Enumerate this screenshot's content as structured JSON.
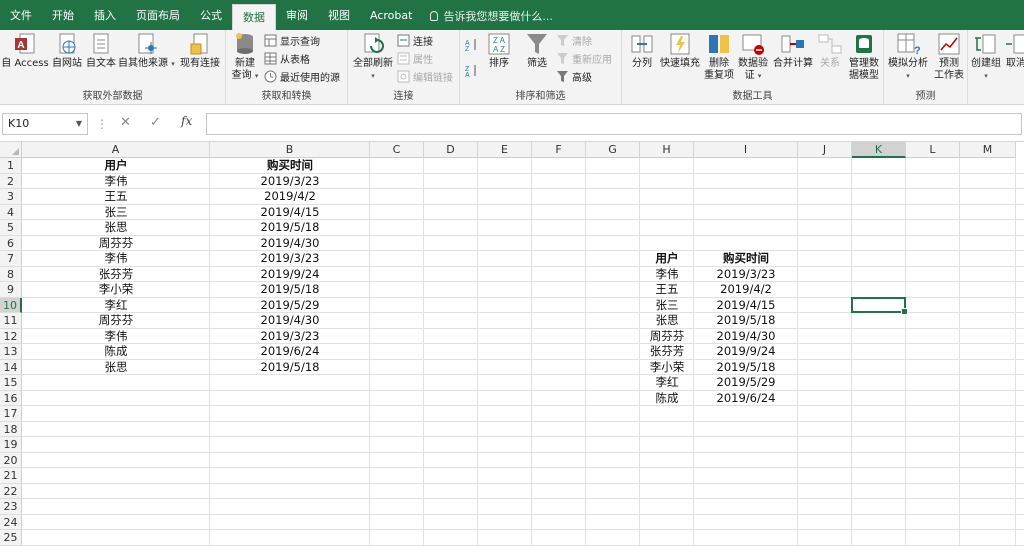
{
  "menu": {
    "tabs": [
      "文件",
      "开始",
      "插入",
      "页面布局",
      "公式",
      "数据",
      "审阅",
      "视图",
      "Acrobat"
    ],
    "active_tab": "数据",
    "tell_me": "告诉我您想要做什么..."
  },
  "ribbon": {
    "get_external": {
      "label": "获取外部数据",
      "access": "自 Access",
      "web": "自网站",
      "text": "自文本",
      "other": "自其他来源",
      "existing": "现有连接"
    },
    "get_transform": {
      "label": "获取和转换",
      "new_query_1": "新建",
      "new_query_2": "查询",
      "show_queries": "显示查询",
      "from_table": "从表格",
      "recent_sources": "最近使用的源"
    },
    "connections": {
      "label": "连接",
      "refresh_all": "全部刷新",
      "connections": "连接",
      "properties": "属性",
      "edit_links": "编辑链接"
    },
    "sort_filter": {
      "label": "排序和筛选",
      "sort": "排序",
      "filter": "筛选",
      "clear": "清除",
      "reapply": "重新应用",
      "advanced": "高级"
    },
    "data_tools": {
      "label": "数据工具",
      "text_to_columns": "分列",
      "flash_fill": "快速填充",
      "remove_dup_1": "删除",
      "remove_dup_2": "重复项",
      "validation_1": "数据验",
      "validation_2": "证",
      "consolidate": "合并计算",
      "relationships": "关系",
      "data_model_1": "管理数",
      "data_model_2": "据模型"
    },
    "forecast": {
      "label": "预测",
      "what_if": "模拟分析",
      "forecast_sheet_1": "预测",
      "forecast_sheet_2": "工作表"
    },
    "outline": {
      "group": "创建组",
      "ungroup": "取消"
    }
  },
  "formula_bar": {
    "name_box": "K10",
    "fx": "fx",
    "formula": ""
  },
  "sheet": {
    "columns": [
      "A",
      "B",
      "C",
      "D",
      "E",
      "F",
      "G",
      "H",
      "I",
      "J",
      "K",
      "L",
      "M"
    ],
    "rows": [
      "1",
      "2",
      "3",
      "4",
      "5",
      "6",
      "7",
      "8",
      "9",
      "10",
      "11",
      "12",
      "13",
      "14",
      "15",
      "16",
      "17",
      "18",
      "19",
      "20",
      "21",
      "22",
      "23",
      "24",
      "25"
    ],
    "selected_cell": "K10",
    "table_left": {
      "header": [
        "用户",
        "购买时间"
      ],
      "rows": [
        [
          "李伟",
          "2019/3/23"
        ],
        [
          "王五",
          "2019/4/2"
        ],
        [
          "张三",
          "2019/4/15"
        ],
        [
          "张思",
          "2019/5/18"
        ],
        [
          "周芬芬",
          "2019/4/30"
        ],
        [
          "李伟",
          "2019/3/23"
        ],
        [
          "张芬芳",
          "2019/9/24"
        ],
        [
          "李小荣",
          "2019/5/18"
        ],
        [
          "李红",
          "2019/5/29"
        ],
        [
          "周芬芬",
          "2019/4/30"
        ],
        [
          "李伟",
          "2019/3/23"
        ],
        [
          "陈成",
          "2019/6/24"
        ],
        [
          "张思",
          "2019/5/18"
        ]
      ]
    },
    "table_right": {
      "header": [
        "用户",
        "购买时间"
      ],
      "rows": [
        [
          "李伟",
          "2019/3/23"
        ],
        [
          "王五",
          "2019/4/2"
        ],
        [
          "张三",
          "2019/4/15"
        ],
        [
          "张思",
          "2019/5/18"
        ],
        [
          "周芬芬",
          "2019/4/30"
        ],
        [
          "张芬芳",
          "2019/9/24"
        ],
        [
          "李小荣",
          "2019/5/18"
        ],
        [
          "李红",
          "2019/5/29"
        ],
        [
          "陈成",
          "2019/6/24"
        ]
      ]
    }
  },
  "colors": {
    "excel_green": "#217346",
    "ribbon_bg": "#f3f3f3",
    "gridline": "#e1e1e1"
  }
}
